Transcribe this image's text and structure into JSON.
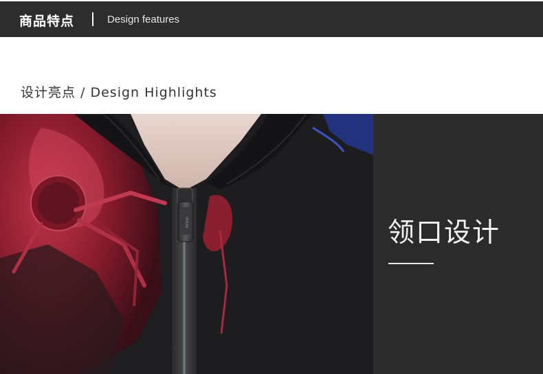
{
  "header": {
    "title_cn": "商品特点",
    "separator": "|",
    "title_en": "Design features"
  },
  "section": {
    "title": "设计亮点 / Design Highlights"
  },
  "feature": {
    "title": "领口设计",
    "zipper_brand": "OYILIN"
  },
  "colors": {
    "header_bg": "#2d2d2d",
    "panel_bg": "#2b2b2b",
    "jacket": "#1f1f21",
    "print_red": "#b21f36",
    "print_blue": "#2a3fa0"
  }
}
